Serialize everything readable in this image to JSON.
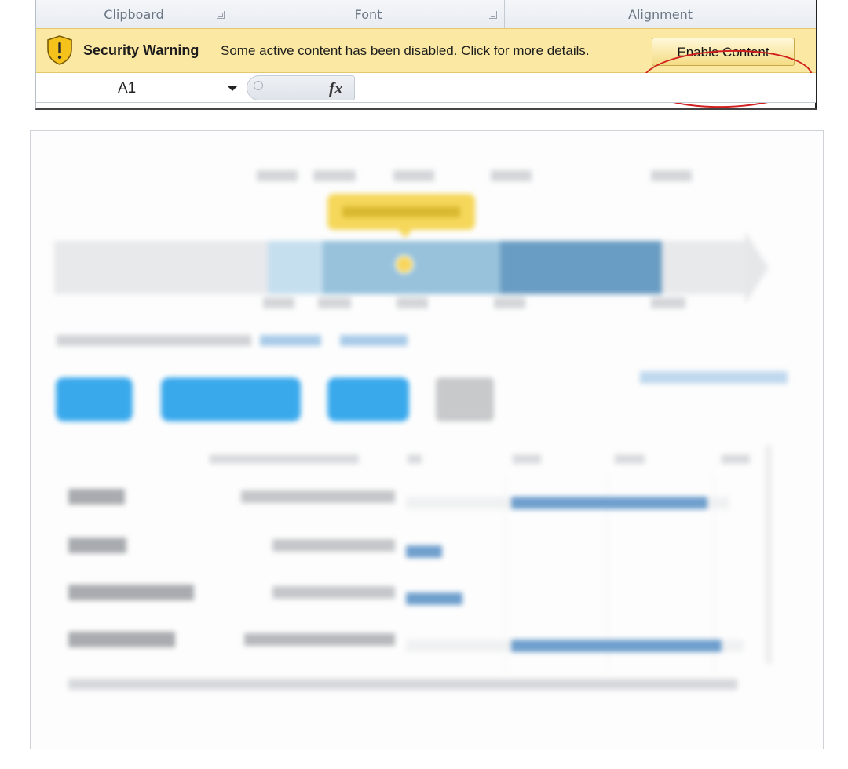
{
  "ribbon": {
    "groups": [
      {
        "label": "Clipboard"
      },
      {
        "label": "Font"
      },
      {
        "label": "Alignment"
      }
    ]
  },
  "message_bar": {
    "title": "Security Warning",
    "message": "Some active content has been disabled. Click for more details.",
    "enable_button": "Enable Content",
    "icon": "shield-warning-icon",
    "highlight_color": "#d02020"
  },
  "formula_bar": {
    "name_box": "A1",
    "fx_label": "fx",
    "formula": ""
  },
  "web_panel": {
    "note": "Blurred salary report content (unreadable)",
    "colors": {
      "accent_button": "#3aa9ec",
      "range_light": "#c6dfef",
      "range_mid": "#98c2dc",
      "range_dark": "#6a9dc3",
      "marker": "#f5d75a",
      "bar": "#6f9fcd"
    }
  }
}
